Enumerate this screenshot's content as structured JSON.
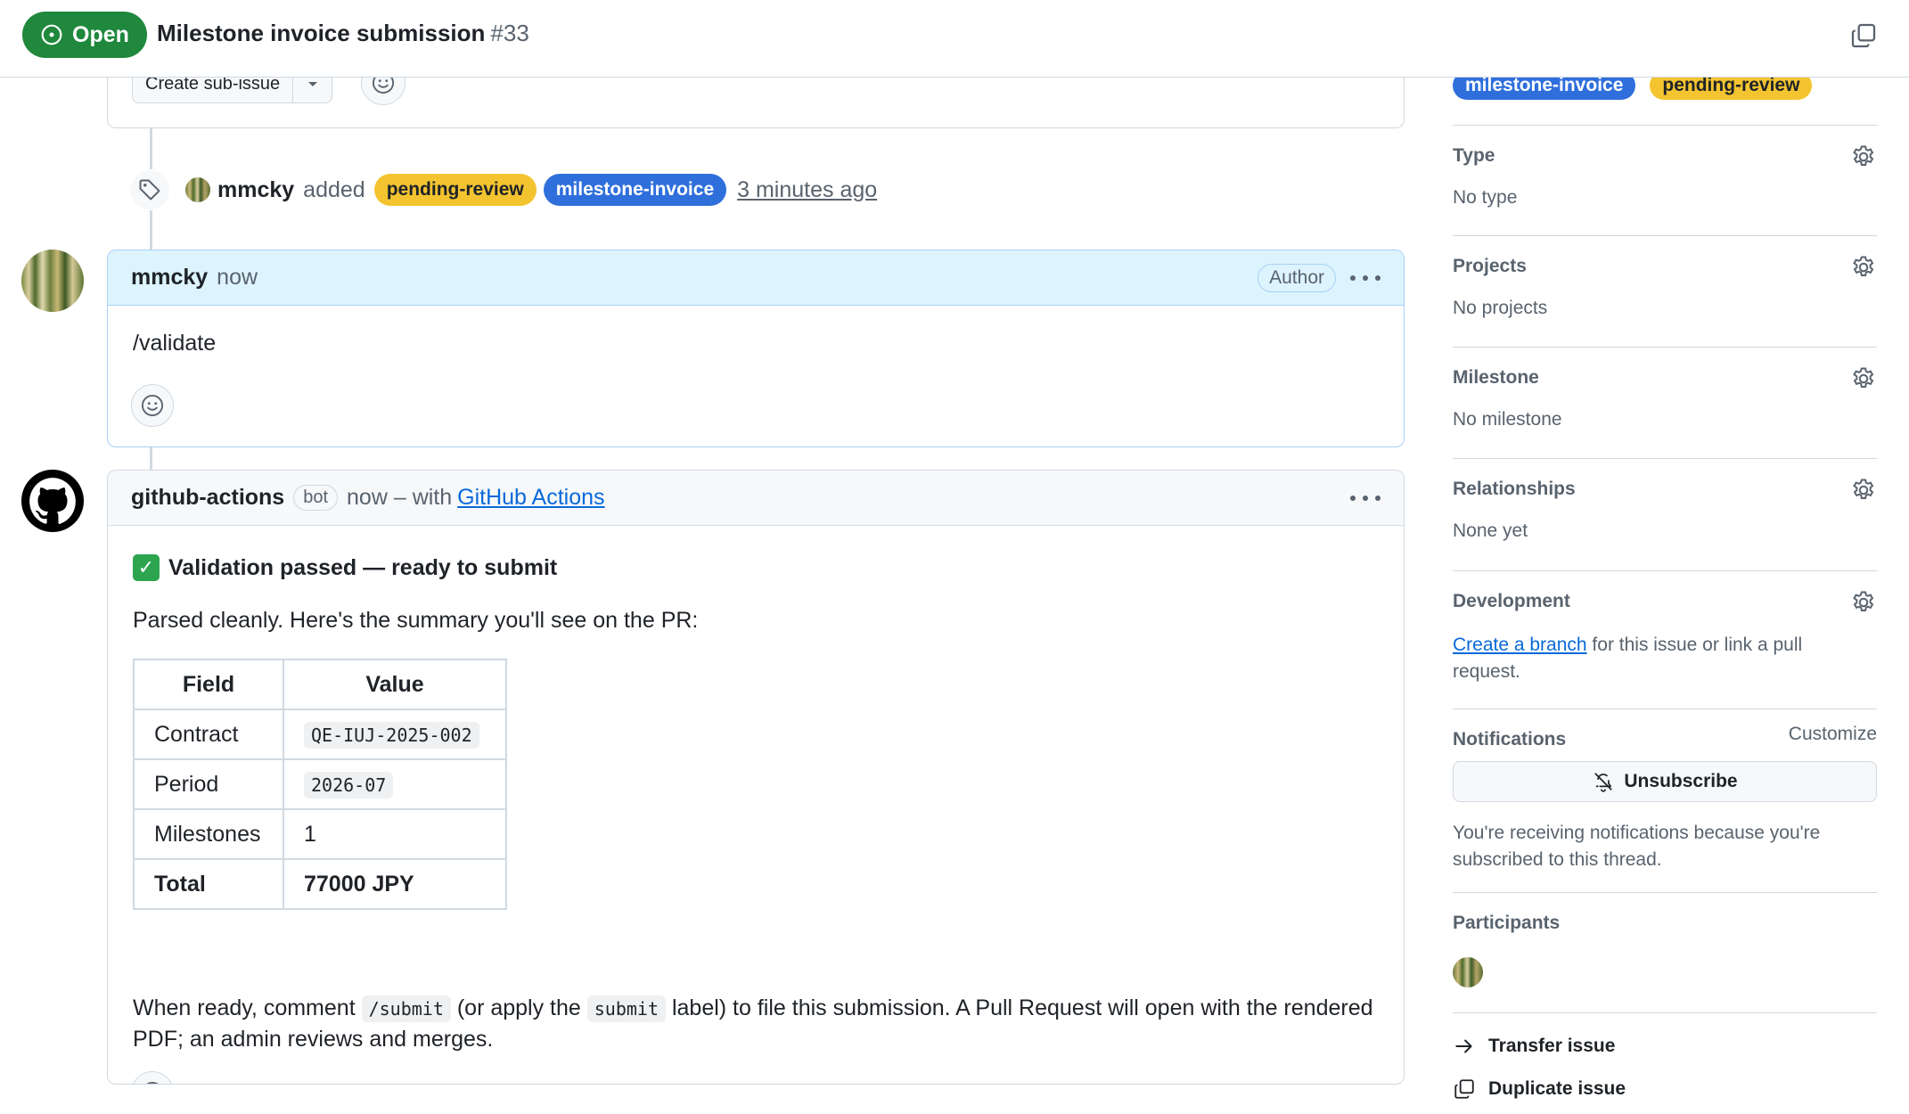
{
  "header": {
    "state": "Open",
    "title": "Milestone invoice submission",
    "number": "#33",
    "copy_icon": "copy-icon"
  },
  "previous_comment": {
    "create_sub_issue_label": "Create sub-issue"
  },
  "event": {
    "user": "mmcky",
    "action": "added",
    "labels": [
      {
        "name": "pending-review",
        "color": "#f4c430"
      },
      {
        "name": "milestone-invoice",
        "color": "#2f6fdc"
      }
    ],
    "time": "3 minutes ago",
    "icon": "tag-icon"
  },
  "comment1": {
    "author": "mmcky",
    "time": "now",
    "author_badge": "Author",
    "body": "/validate"
  },
  "comment2": {
    "author": "github-actions",
    "bot_badge": "bot",
    "meta": "now – with",
    "app_link": "GitHub Actions",
    "heading": "Validation passed — ready to submit",
    "intro": "Parsed cleanly. Here's the summary you'll see on the PR:",
    "table": {
      "headers": [
        "Field",
        "Value"
      ],
      "rows": [
        {
          "field": "Contract",
          "value": "QE-IUJ-2025-002",
          "code": true
        },
        {
          "field": "Period",
          "value": "2026-07",
          "code": true
        },
        {
          "field": "Milestones",
          "value": "1",
          "code": false
        }
      ],
      "total": {
        "field": "Total",
        "value": "77000 JPY"
      }
    },
    "footer": {
      "p1": "When ready, comment",
      "code1": "/submit",
      "p2": "(or apply the",
      "code2": "submit",
      "p3": "label) to file this submission. A Pull Request will open with the rendered PDF; an admin reviews and merges."
    }
  },
  "sidebar": {
    "labels": [
      {
        "name": "milestone-invoice",
        "color": "#2f6fdc"
      },
      {
        "name": "pending-review",
        "color": "#f4c430"
      }
    ],
    "type": {
      "title": "Type",
      "value": "No type"
    },
    "projects": {
      "title": "Projects",
      "value": "No projects"
    },
    "milestone": {
      "title": "Milestone",
      "value": "No milestone"
    },
    "relationships": {
      "title": "Relationships",
      "value": "None yet"
    },
    "development": {
      "title": "Development",
      "link": "Create a branch",
      "rest": " for this issue or link a pull request."
    },
    "notifications": {
      "title": "Notifications",
      "customize": "Customize",
      "button": "Unsubscribe",
      "text": "You're receiving notifications because you're subscribed to this thread."
    },
    "participants": {
      "title": "Participants"
    },
    "actions": {
      "transfer": "Transfer issue",
      "duplicate": "Duplicate issue"
    }
  },
  "colors": {
    "open_green": "#1f883d",
    "link_blue": "#0969da",
    "author_header_bg": "#ddf4ff"
  }
}
